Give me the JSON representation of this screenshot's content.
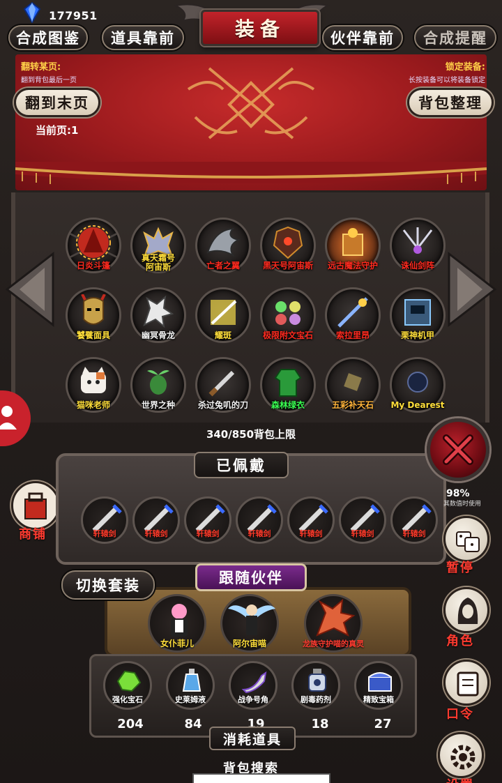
{
  "status": {
    "currency": "177951"
  },
  "header": {
    "title": "装备",
    "tabs": [
      {
        "label": "合成图鉴",
        "dim": false
      },
      {
        "label": "道具靠前",
        "dim": false
      },
      {
        "label": "伙伴靠前",
        "dim": false
      },
      {
        "label": "合成提醒",
        "dim": true
      }
    ]
  },
  "hints": {
    "left_title": "翻转某页:",
    "left_sub": "翻到背包最后一页",
    "right_title": "锁定装备:",
    "right_sub": "长按装备可以将装备锁定"
  },
  "controls": {
    "last_page": "翻到末页",
    "sort_bag": "背包整理",
    "current_page": "当前页:1"
  },
  "bag": {
    "items": [
      {
        "name": "日炎斗篷",
        "color": "red",
        "icon": "cloak-icon"
      },
      {
        "name": "真天霜号阿宙斯",
        "color": "yellow",
        "icon": "mech-icon"
      },
      {
        "name": "亡者之翼",
        "color": "red",
        "icon": "wing-icon"
      },
      {
        "name": "黑天号阿宙斯",
        "color": "red",
        "icon": "armor-icon"
      },
      {
        "name": "远古魔法守护",
        "color": "red",
        "icon": "shrine-icon"
      },
      {
        "name": "诛仙剑阵",
        "color": "red",
        "icon": "sword-array-icon"
      },
      {
        "name": "饕餮面具",
        "color": "yellow",
        "icon": "mask-icon"
      },
      {
        "name": "幽冥骨龙",
        "color": "white",
        "icon": "bone-dragon-icon"
      },
      {
        "name": "耀斑",
        "color": "yellow",
        "icon": "flare-icon"
      },
      {
        "name": "极限附文宝石",
        "color": "red",
        "icon": "gems-icon"
      },
      {
        "name": "索拉里昂",
        "color": "red",
        "icon": "staff-icon"
      },
      {
        "name": "栗神机甲",
        "color": "yellow",
        "icon": "mecha-icon"
      },
      {
        "name": "猫咪老师",
        "color": "yellow",
        "icon": "cat-icon"
      },
      {
        "name": "世界之种",
        "color": "white",
        "icon": "seed-icon"
      },
      {
        "name": "杀过兔叽的刀",
        "color": "white",
        "icon": "knife-icon"
      },
      {
        "name": "森林绿衣",
        "color": "green",
        "icon": "green-coat-icon"
      },
      {
        "name": "五彩补天石",
        "color": "orange",
        "icon": "stone-icon"
      },
      {
        "name": "My Dearest",
        "color": "yellow",
        "icon": "dark-orb-icon"
      }
    ],
    "capacity": "340/850背包上限"
  },
  "equipped": {
    "title": "已佩戴",
    "slots": [
      "轩辕剑",
      "轩辕剑",
      "轩辕剑",
      "轩辕剑",
      "轩辕剑",
      "轩辕剑",
      "轩辕剑"
    ]
  },
  "side": {
    "shop": "商铺",
    "pause": "暂停",
    "role": "角色",
    "command": "口令",
    "settings": "设置",
    "note_pct": "98%",
    "note_sub": "其数值时使用"
  },
  "partners": {
    "switch_label": "切换套装",
    "title": "跟随伙伴",
    "list": [
      {
        "name": "女仆菲儿",
        "color": "yellow",
        "icon": "maid-icon"
      },
      {
        "name": "阿尔宙喵",
        "color": "yellow",
        "icon": "angel-icon"
      },
      {
        "name": "龙族守护喵的真灵",
        "color": "red",
        "icon": "fire-dragon-icon"
      }
    ]
  },
  "consumables": {
    "title": "消耗道具",
    "items": [
      {
        "name": "强化宝石",
        "count": "204",
        "icon": "green-gem-icon"
      },
      {
        "name": "史莱姆液",
        "count": "84",
        "icon": "potion-icon"
      },
      {
        "name": "战争号角",
        "count": "19",
        "icon": "horn-icon"
      },
      {
        "name": "剧毒药剂",
        "count": "18",
        "icon": "poison-icon"
      },
      {
        "name": "精致宝箱",
        "count": "27",
        "icon": "chest-icon"
      }
    ]
  },
  "search": {
    "title": "背包搜索",
    "value": ""
  },
  "colors": {
    "red_banner": "#9a1a1d",
    "label_yellow": "#ffde3a",
    "label_red": "#ff2a1f",
    "label_green": "#3aff52",
    "purple_banner": "#7a2b8c"
  }
}
